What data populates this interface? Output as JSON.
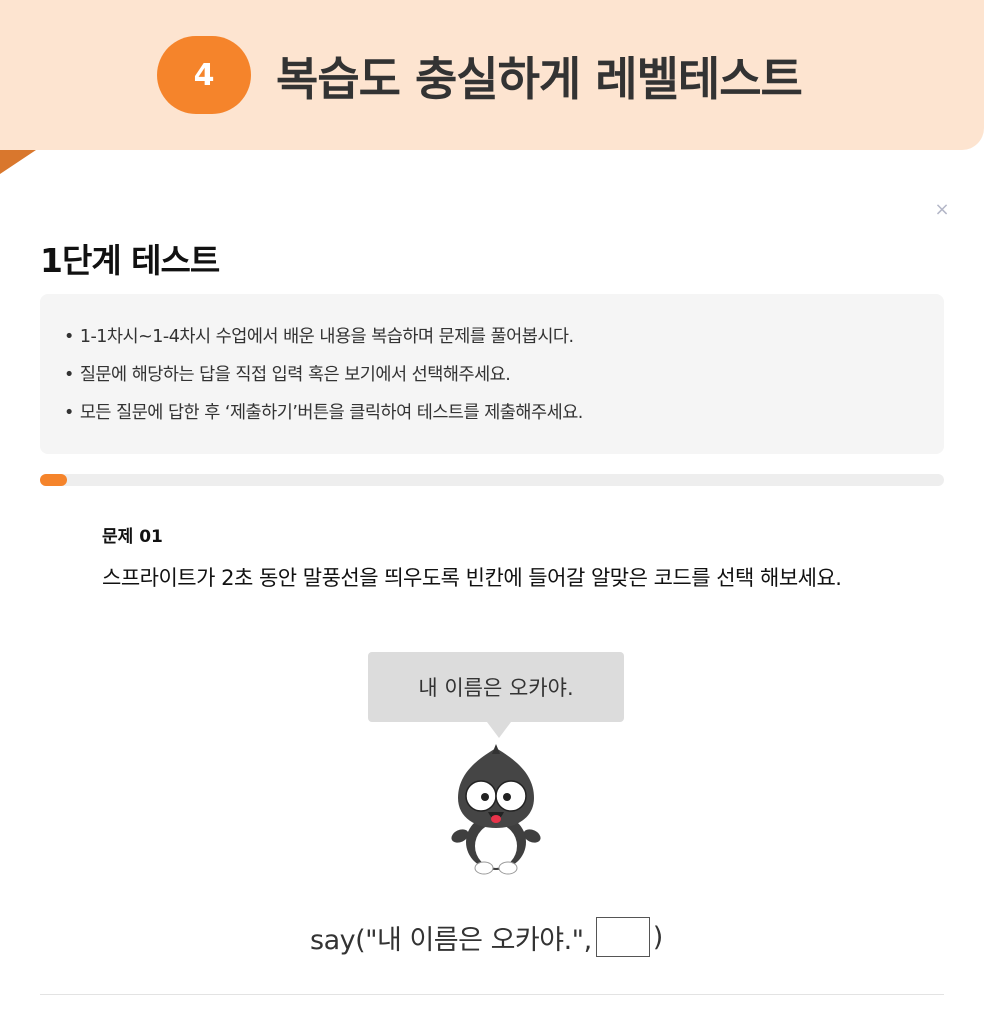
{
  "banner": {
    "step_number": "4",
    "title": "복습도 충실하게 레벨테스트"
  },
  "close_icon": "×",
  "test": {
    "title": "1단계 테스트",
    "instructions": [
      "1-1차시~1-4차시 수업에서 배운 내용을 복습하며 문제를 풀어봅시다.",
      "질문에 해당하는 답을 직접 입력 혹은 보기에서 선택해주세요.",
      "모든 질문에 답한 후 ‘제출하기’버튼을 클릭하여 테스트를 제출해주세요."
    ],
    "progress": 0.03
  },
  "question": {
    "label": "문제 01",
    "text": "스프라이트가 2초 동안 말풍선을 띄우도록 빈칸에 들어갈 알맞은 코드를 선택 해보세요.",
    "speech_bubble": "내 이름은 오카야.",
    "code_prefix": "say(\"내 이름은 오카야.\",",
    "code_suffix": ")"
  },
  "colors": {
    "accent": "#f5842b",
    "banner_bg": "#fde4d0",
    "info_bg": "#f5f5f5"
  }
}
